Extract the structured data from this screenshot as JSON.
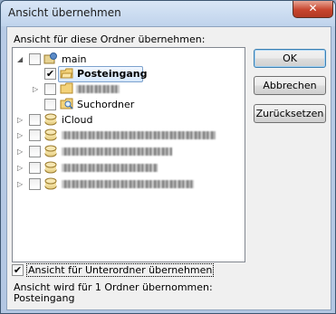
{
  "window": {
    "title": "Ansicht übernehmen",
    "close_glyph": "✕"
  },
  "label_top": "Ansicht für diese Ordner übernehmen:",
  "tree": {
    "main": {
      "label": "main",
      "expander": "◢",
      "checked": false
    },
    "posteingang": {
      "label": "Posteingang",
      "checked": true
    },
    "hidden_folder": {
      "label": "",
      "expander": "▷"
    },
    "suchordner": {
      "label": "Suchordner"
    },
    "icloud": {
      "label": "iCloud",
      "expander": "▷"
    },
    "redacted_items": [
      {
        "expander": "▷"
      },
      {
        "expander": "▷"
      },
      {
        "expander": "▷"
      },
      {
        "expander": "▷"
      }
    ]
  },
  "buttons": {
    "ok": "OK",
    "cancel": "Abbrechen",
    "reset": "Zurücksetzen"
  },
  "subfolder_option": {
    "label": "Ansicht für Unterordner übernehmen",
    "checked": true
  },
  "info": {
    "line1": "Ansicht wird für 1 Ordner übernommen:",
    "line2": "Posteingang"
  },
  "check_glyph": "✔",
  "colors": {
    "title_bar": "#c9daf0",
    "close": "#c7452e",
    "selection": "#d6e8fd"
  }
}
